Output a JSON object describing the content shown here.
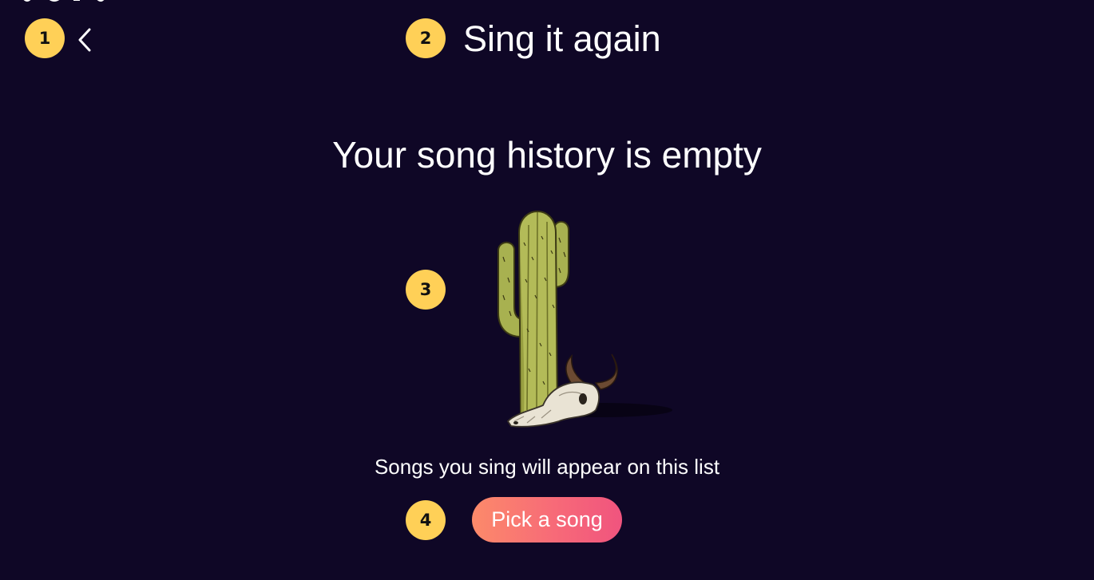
{
  "header": {
    "title": "Sing it again",
    "back_icon": "chevron-left-icon"
  },
  "empty_state": {
    "title": "Your song history is empty",
    "illustration": "cactus-with-skull-illustration",
    "subtitle": "Songs you sing will appear on this list",
    "button_label": "Pick a song"
  },
  "annotations": {
    "badge_1": "1",
    "badge_2": "2",
    "badge_3": "3",
    "badge_4": "4"
  },
  "colors": {
    "background": "#0f0726",
    "badge": "#ffd057",
    "button_gradient_start": "#fc8a6a",
    "button_gradient_end": "#f0547e",
    "text": "#ffffff"
  }
}
